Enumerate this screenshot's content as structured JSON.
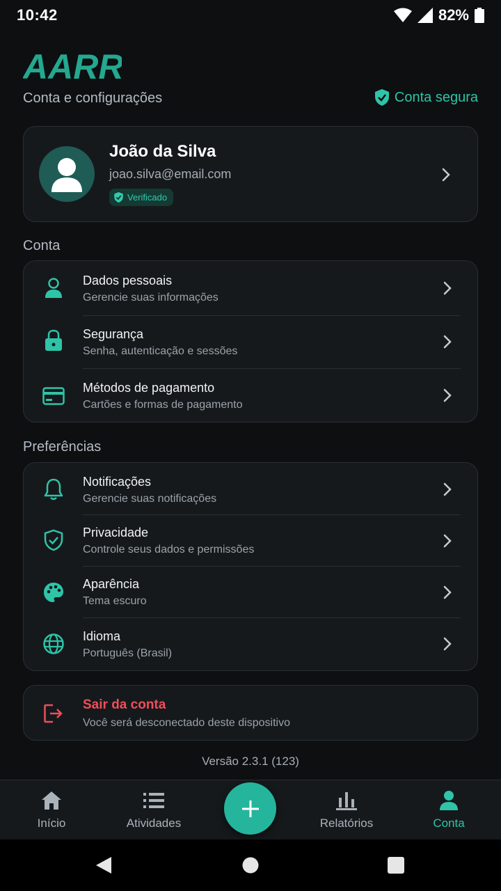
{
  "status_bar": {
    "time": "10:42",
    "battery": "82%"
  },
  "header": {
    "logo_text": "AARR",
    "subtitle": "Conta e configurações",
    "secure_label": "Conta segura"
  },
  "profile": {
    "name": "João da Silva",
    "email": "joao.silva@email.com",
    "badge": "Verificado"
  },
  "sections": {
    "account": {
      "title": "Conta",
      "items": [
        {
          "title": "Dados pessoais",
          "subtitle": "Gerencie suas informações",
          "icon": "person-icon"
        },
        {
          "title": "Segurança",
          "subtitle": "Senha, autenticação e sessões",
          "icon": "lock-icon"
        },
        {
          "title": "Métodos de pagamento",
          "subtitle": "Cartões e formas de pagamento",
          "icon": "credit-card-icon"
        }
      ]
    },
    "preferences": {
      "title": "Preferências",
      "items": [
        {
          "title": "Notificações",
          "subtitle": "Gerencie suas notificações",
          "icon": "bell-icon"
        },
        {
          "title": "Privacidade",
          "subtitle": "Controle seus dados e permissões",
          "icon": "shield-check-icon"
        },
        {
          "title": "Aparência",
          "subtitle": "Tema escuro",
          "icon": "palette-icon"
        },
        {
          "title": "Idioma",
          "subtitle": "Português (Brasil)",
          "icon": "globe-icon"
        }
      ]
    }
  },
  "logout": {
    "title": "Sair da conta",
    "subtitle": "Você será desconectado deste dispositivo"
  },
  "version": "Versão 2.3.1 (123)",
  "bottom_nav": {
    "items": [
      {
        "label": "Início",
        "icon": "home-icon"
      },
      {
        "label": "Atividades",
        "icon": "list-icon"
      },
      {
        "label": "Relatórios",
        "icon": "bar-chart-icon"
      },
      {
        "label": "Conta",
        "icon": "person-icon",
        "active": true
      }
    ],
    "fab_icon": "plus-icon"
  },
  "colors": {
    "accent": "#2ec4a8",
    "danger": "#ef4e5a",
    "background": "#0d0f11",
    "card": "#16191c"
  }
}
